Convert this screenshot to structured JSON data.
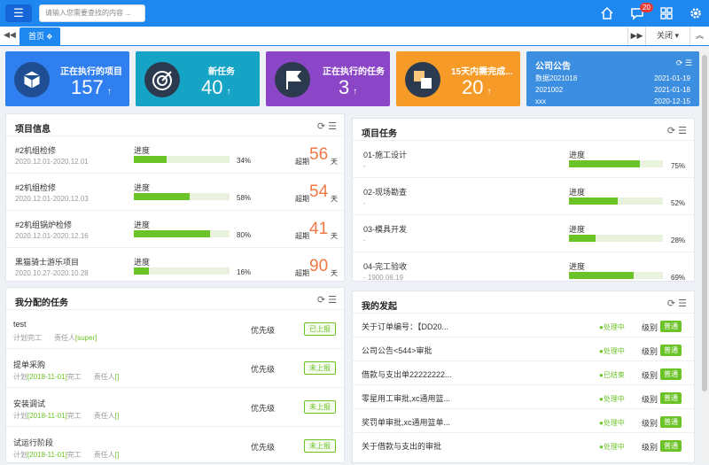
{
  "header": {
    "search_placeholder": "请输入您需要查找的内容 ...",
    "msg_count": "20"
  },
  "tabs": {
    "home": "首页",
    "close": "关闭"
  },
  "cards": [
    {
      "label": "正在执行的项目",
      "value": "157",
      "color": "#2f7ff0"
    },
    {
      "label": "新任务",
      "value": "40",
      "color": "#16a4c6"
    },
    {
      "label": "正在执行的任务",
      "value": "3",
      "color": "#8b46c7"
    },
    {
      "label": "15天内需完成...",
      "value": "20",
      "color": "#f79b28"
    }
  ],
  "notice": {
    "title": "公司公告",
    "items": [
      {
        "name": "数据2021018",
        "date": "2021-01-19"
      },
      {
        "name": "2021002",
        "date": "2021-01-18"
      },
      {
        "name": "xxx",
        "date": "2020-12-15"
      }
    ]
  },
  "project_info": {
    "title": "项目信息",
    "progress_label": "进度",
    "overdue_label": "超期",
    "unit": "天",
    "items": [
      {
        "name": "#2机组检修",
        "period": "2020.12.01-2020.12.01",
        "pct": "34%",
        "progress": 0.34,
        "days": "56"
      },
      {
        "name": "#2机组检修",
        "period": "2020.12.01-2020.12.03",
        "pct": "58%",
        "progress": 0.58,
        "days": "54"
      },
      {
        "name": "#2机组锅炉检修",
        "period": "2020.12.01-2020.12.16",
        "pct": "80%",
        "progress": 0.8,
        "days": "41"
      },
      {
        "name": "黑猫骑士游乐项目",
        "period": "2020.10.27-2020.10.28",
        "pct": "16%",
        "progress": 0.16,
        "days": "90"
      }
    ]
  },
  "project_tasks": {
    "title": "项目任务",
    "progress_label": "进度",
    "items": [
      {
        "name": "01-施工设计",
        "sub": "-",
        "pct": "75%",
        "progress": 0.75
      },
      {
        "name": "02-现场勘查",
        "sub": "-",
        "pct": "52%",
        "progress": 0.52
      },
      {
        "name": "03-模具开发",
        "sub": "-",
        "pct": "28%",
        "progress": 0.28
      },
      {
        "name": "04-完工验收",
        "sub": "- 1900.06.19",
        "pct": "69%",
        "progress": 0.69
      }
    ]
  },
  "assigned": {
    "title": "我分配的任务",
    "priority_label": "优先级",
    "items": [
      {
        "name": "test",
        "plan": "计划",
        "plan_date": "",
        "done": "完工",
        "owner_label": "责任人",
        "owner": "[super]",
        "status": "已上报"
      },
      {
        "name": "提单采购",
        "plan": "计划",
        "plan_date": "[2018-11-01]",
        "done": "完工",
        "owner_label": "责任人",
        "owner": "[]",
        "status": "未上报"
      },
      {
        "name": "安装调试",
        "plan": "计划",
        "plan_date": "[2018-11-01]",
        "done": "完工",
        "owner_label": "责任人",
        "owner": "[]",
        "status": "未上报"
      },
      {
        "name": "试运行阶段",
        "plan": "计划",
        "plan_date": "[2018-11-01]",
        "done": "完工",
        "owner_label": "责任人",
        "owner": "[]",
        "status": "未上报"
      }
    ]
  },
  "initiated": {
    "title": "我的发起",
    "level_label": "级别",
    "items": [
      {
        "name": "关于订单编号：【DD20...",
        "status": "●处理中",
        "level": "普通"
      },
      {
        "name": "公司公告<544>审批",
        "status": "●处理中",
        "level": "普通"
      },
      {
        "name": "借款与支出单22222222...",
        "status": "●已结束",
        "level": "普通"
      },
      {
        "name": "零星用工审批,xc通用篮...",
        "status": "●处理中",
        "level": "普通"
      },
      {
        "name": "奖罚单审批,xc通用篮单...",
        "status": "●处理中",
        "level": "普通"
      },
      {
        "name": "关于借款与支出的审批",
        "status": "●处理中",
        "level": "普通"
      }
    ]
  }
}
